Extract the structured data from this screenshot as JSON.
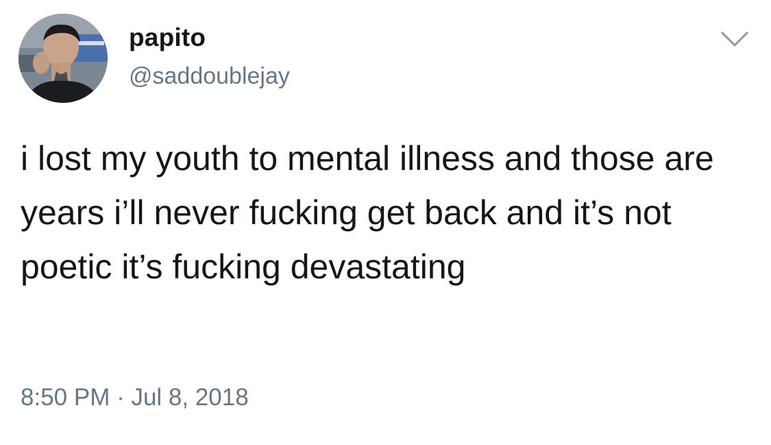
{
  "user": {
    "display_name": "papito",
    "handle": "@saddoublejay",
    "avatar_icon": "profile-photo"
  },
  "tweet": {
    "text": "i lost my youth to mental illness and those are years i’ll never fucking get back and it’s not poetic it’s fucking devastating",
    "timestamp": "8:50 PM · Jul 8, 2018"
  },
  "menu": {
    "icon": "chevron-down-icon"
  },
  "colors": {
    "text_primary": "#14171a",
    "text_secondary": "#657786",
    "background": "#ffffff"
  }
}
